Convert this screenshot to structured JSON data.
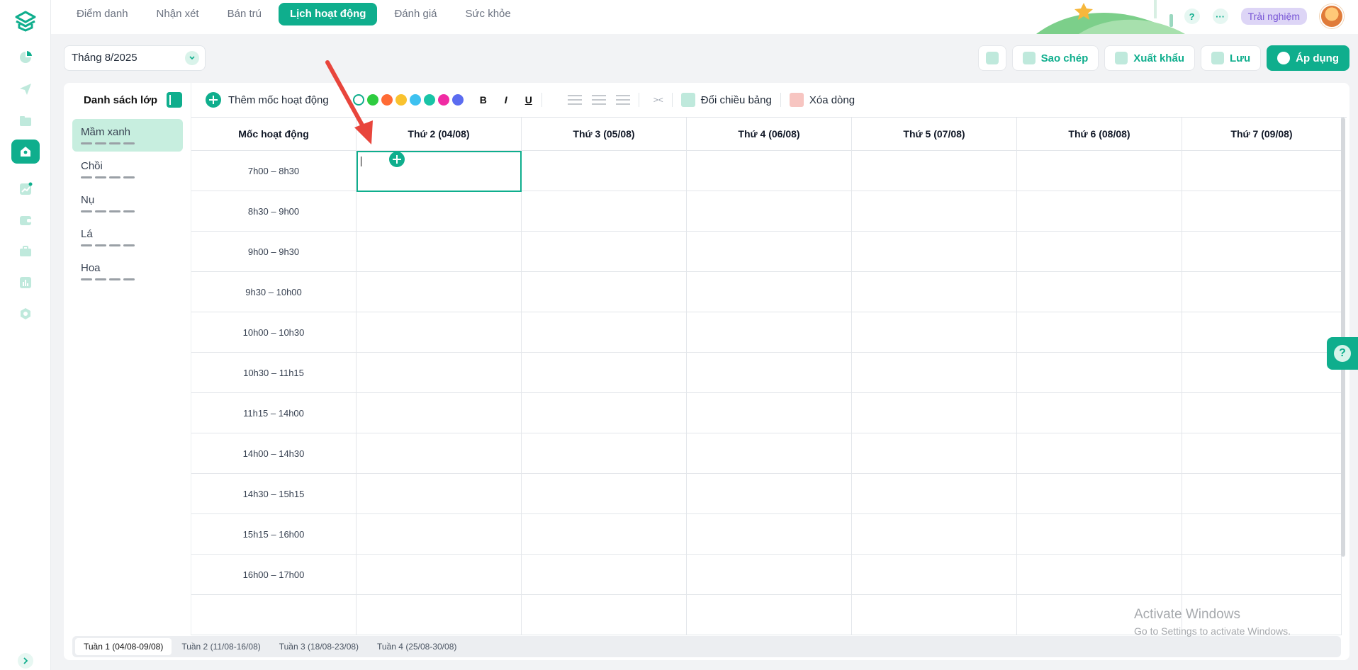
{
  "nav": {
    "tabs": [
      {
        "label": "Điểm danh"
      },
      {
        "label": "Nhận xét"
      },
      {
        "label": "Bán trú"
      },
      {
        "label": "Lịch hoạt động"
      },
      {
        "label": "Đánh giá"
      },
      {
        "label": "Sức khỏe"
      }
    ],
    "active_tab": "Lịch hoạt động",
    "help_label": "?",
    "more_label": "···",
    "trial_label": "Trải nghiệm"
  },
  "month_select": {
    "value": "Tháng 8/2025"
  },
  "actions": {
    "copy_label": "Sao chép",
    "export_label": "Xuất khẩu",
    "save_label": "Lưu",
    "apply_label": "Áp dụng"
  },
  "class_list": {
    "title": "Danh sách lớp",
    "items": [
      {
        "label": "Mầm xanh"
      },
      {
        "label": "Chồi"
      },
      {
        "label": "Nụ"
      },
      {
        "label": "Lá"
      },
      {
        "label": "Hoa"
      }
    ],
    "selected": "Mầm xanh"
  },
  "toolbar": {
    "add_milestone_label": "Thêm mốc hoạt động",
    "colors": [
      "none",
      "#2ecc40",
      "#ff6b35",
      "#f9c22e",
      "#3ec1f0",
      "#19c4a6",
      "#f02ba3",
      "#5b6cf0"
    ],
    "bold": "B",
    "italic": "I",
    "underline": "U",
    "merge": "><",
    "transpose_label": "Đổi chiều bảng",
    "delete_row_label": "Xóa dòng"
  },
  "schedule": {
    "time_header": "Mốc hoạt động",
    "days": [
      "Thứ 2 (04/08)",
      "Thứ 3 (05/08)",
      "Thứ 4 (06/08)",
      "Thứ 5 (07/08)",
      "Thứ 6 (08/08)",
      "Thứ 7 (09/08)"
    ],
    "slots": [
      "7h00 – 8h30",
      "8h30 – 9h00",
      "9h00 – 9h30",
      "9h30 – 10h00",
      "10h00 – 10h30",
      "10h30 – 11h15",
      "11h15 – 14h00",
      "14h00 – 14h30",
      "14h30 – 15h15",
      "15h15 – 16h00",
      "16h00 – 17h00"
    ]
  },
  "weeks": [
    {
      "label": "Tuần 1",
      "range": "(04/08-09/08)",
      "active": true
    },
    {
      "label": "Tuần 2",
      "range": "(11/08-16/08)",
      "active": false
    },
    {
      "label": "Tuần 3",
      "range": "(18/08-23/08)",
      "active": false
    },
    {
      "label": "Tuần 4",
      "range": "(25/08-30/08)",
      "active": false
    }
  ],
  "watermark": {
    "line1": "Activate Windows",
    "line2": "Go to Settings to activate Windows."
  },
  "help_fab": "?",
  "colors": {
    "accent": "#0fae8d",
    "annotation_arrow": "#e8453c"
  }
}
